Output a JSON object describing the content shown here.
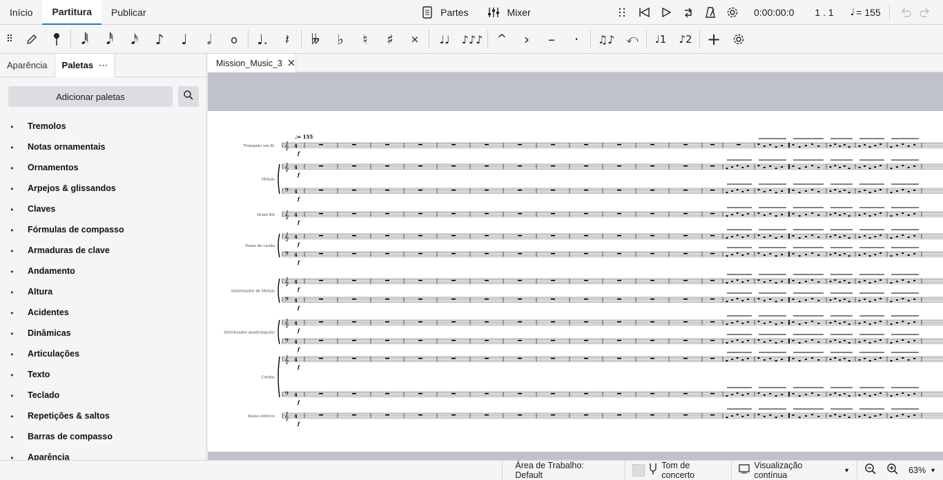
{
  "top_tabs": [
    "Início",
    "Partitura",
    "Publicar"
  ],
  "top_center": {
    "parts_label": "Partes",
    "mixer_label": "Mixer"
  },
  "playback": {
    "time": "0:00:00:0",
    "position": "1 . 1",
    "tempo": "= 155"
  },
  "left_panel": {
    "tabs": [
      "Aparência",
      "Paletas"
    ],
    "more_label": "⋯",
    "add_palettes_label": "Adicionar paletas",
    "palettes": [
      "Tremolos",
      "Notas ornamentais",
      "Ornamentos",
      "Arpejos & glissandos",
      "Claves",
      "Fórmulas de compasso",
      "Armaduras de clave",
      "Andamento",
      "Altura",
      "Acidentes",
      "Dinâmicas",
      "Articulações",
      "Texto",
      "Teclado",
      "Repetições & saltos",
      "Barras de compasso",
      "Aparência"
    ]
  },
  "score_tab": {
    "title": "Mission_Music_3"
  },
  "score": {
    "tempo_mark": "♩= 155",
    "instruments": [
      {
        "name": "Trompete em B♭",
        "staves": 1
      },
      {
        "name": "Metais",
        "staves": 2
      },
      {
        "name": "Drum Kit",
        "staves": 1
      },
      {
        "name": "Piano de cauda",
        "staves": 2
      },
      {
        "name": "Sintetizador de Metais",
        "staves": 2
      },
      {
        "name": "Sintetizador quadrangular",
        "staves": 2
      },
      {
        "name": "Cordas",
        "staves": 2
      },
      {
        "name": "Baixo elétrico",
        "staves": 1
      }
    ]
  },
  "status_bar": {
    "workspace": "Área de Trabalho: Default",
    "concert_pitch": "Tom de concerto",
    "view_mode": "Visualização contínua",
    "zoom": "63%"
  },
  "colors": {
    "accent": "#2b6fd6",
    "page": "#ffffff",
    "canvas_bg": "#bfc2cb"
  },
  "icons": [
    "document-icon",
    "mixer-icon",
    "rewind-icon",
    "play-icon",
    "loop-icon",
    "metronome-icon",
    "settings-icon",
    "undo-icon",
    "redo-icon",
    "search-icon",
    "close-icon",
    "zoom-out-icon",
    "zoom-in-icon",
    "tuning-fork-icon",
    "view-mode-icon"
  ]
}
